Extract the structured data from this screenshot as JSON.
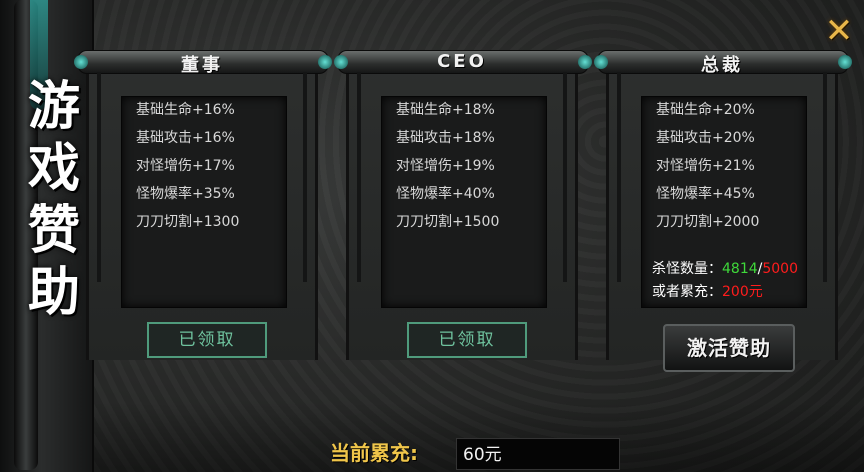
{
  "side_title": "游\n戏\n赞\n助",
  "close_icon": "close-x-icon",
  "panels": [
    {
      "title": "董事",
      "perks": [
        "基础生命+16%",
        "基础攻击+16%",
        "对怪增伤+17%",
        "怪物爆率+35%",
        "刀刀切割+1300"
      ],
      "button": "已领取"
    },
    {
      "title": "CEO",
      "perks": [
        "基础生命+18%",
        "基础攻击+18%",
        "对怪增伤+19%",
        "怪物爆率+40%",
        "刀刀切割+1500"
      ],
      "button": "已领取"
    },
    {
      "title": "总裁",
      "perks": [
        "基础生命+20%",
        "基础攻击+20%",
        "对怪增伤+21%",
        "怪物爆率+45%",
        "刀刀切割+2000"
      ],
      "kill_label": "杀怪数量：",
      "kill_current": "4814",
      "kill_sep": "/",
      "kill_required": "5000",
      "recharge_label": "或者累充：",
      "recharge_required": "200元",
      "button": "激活赞助"
    }
  ],
  "bottom": {
    "label": "当前累充:",
    "value": "60元"
  },
  "colors": {
    "gold": "#f0c64a",
    "claimed_green": "#6fc29e",
    "progress_green": "#3fd93a",
    "requirement_red": "#ff1c1c"
  }
}
